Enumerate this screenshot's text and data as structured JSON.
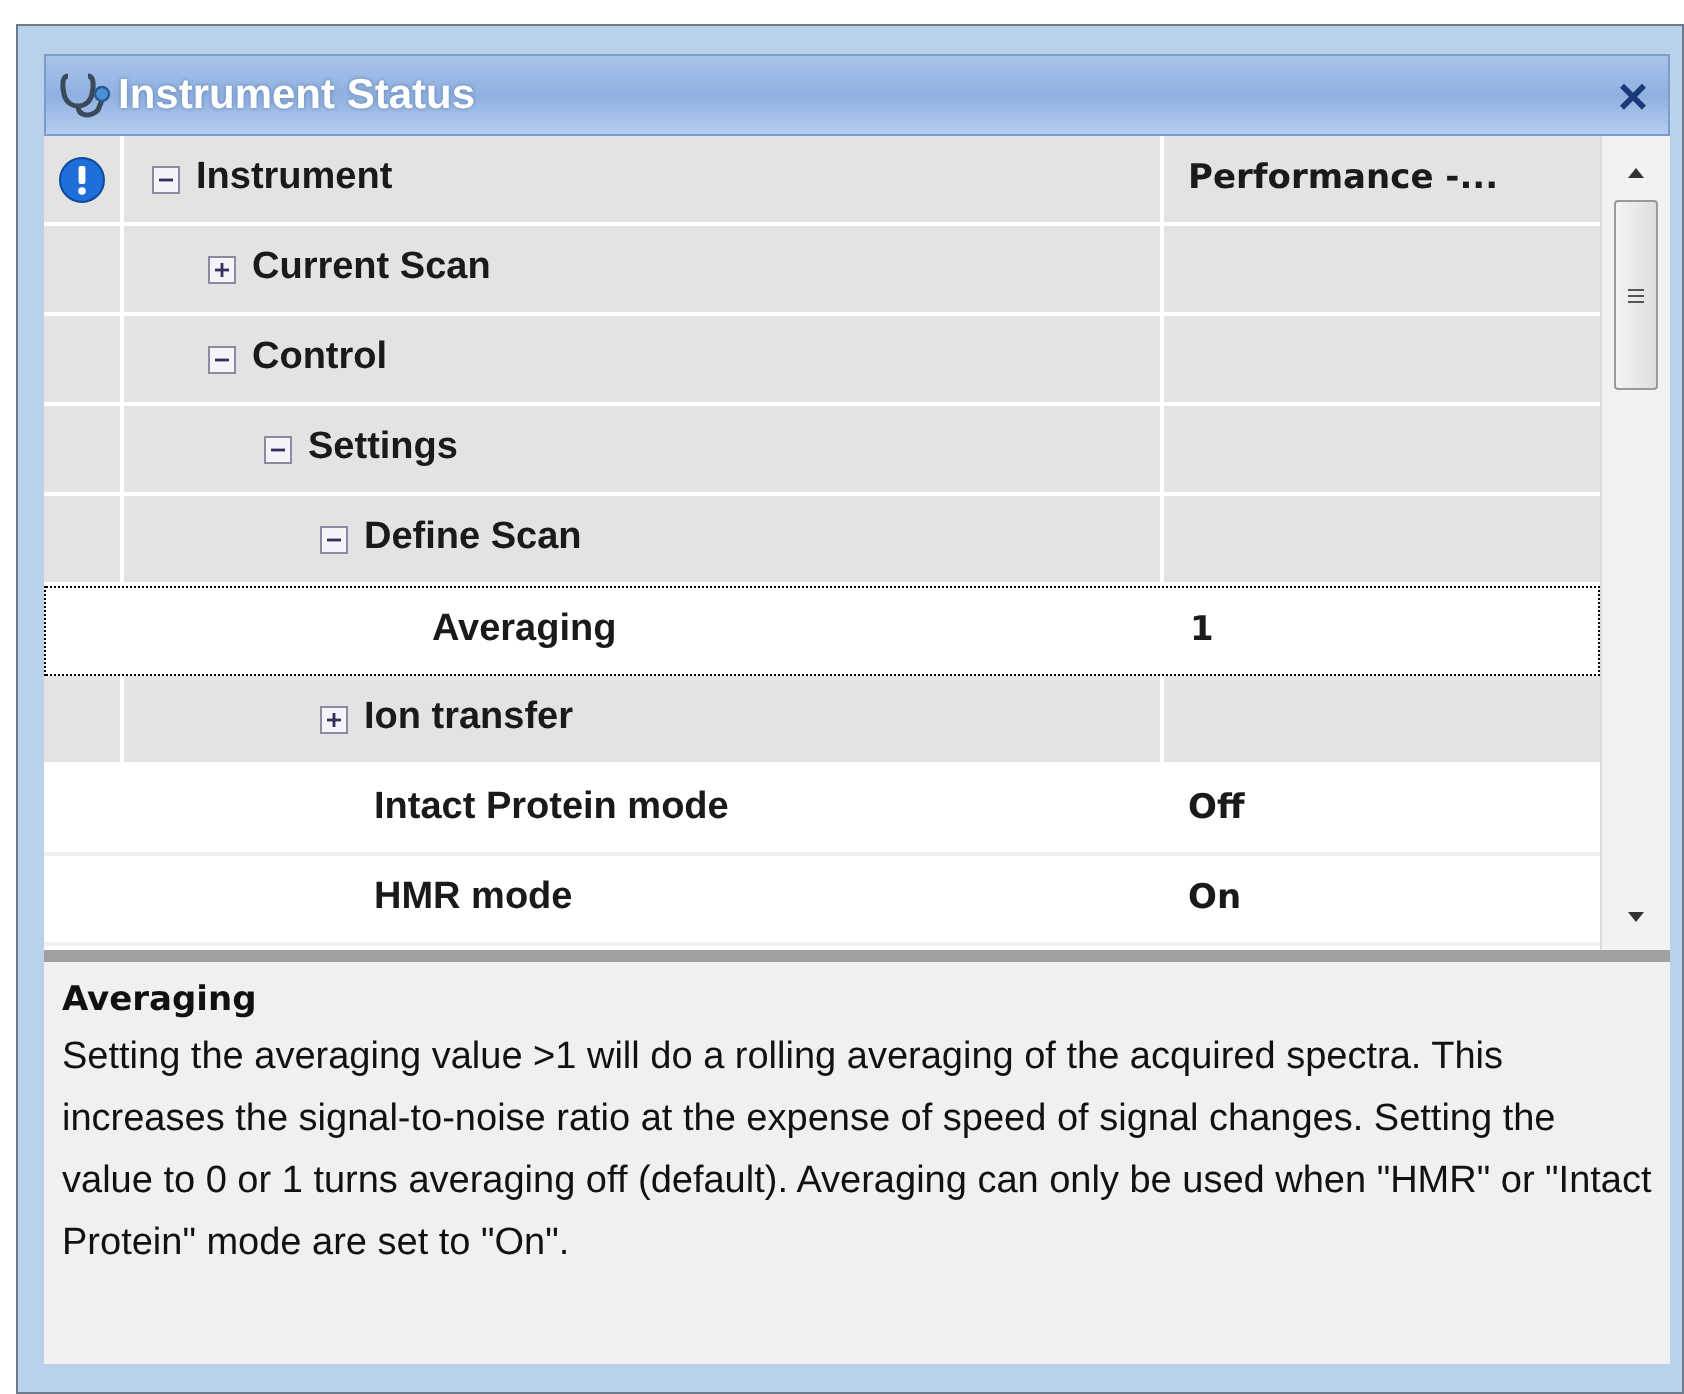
{
  "window": {
    "title": "Instrument Status",
    "close": "×"
  },
  "tree": [
    {
      "name": "Instrument",
      "value": "Performance -...",
      "expanded": true,
      "selected": false,
      "children": [
        {
          "name": "Current Scan",
          "expanded": false,
          "selected": false
        },
        {
          "name": "Control",
          "expanded": true,
          "selected": false,
          "children": [
            {
              "name": "Settings",
              "expanded": true,
              "selected": false,
              "children": [
                {
                  "name": "Define Scan",
                  "expanded": true,
                  "selected": false,
                  "children": [
                    {
                      "name": "Averaging",
                      "value": "1",
                      "selected": true
                    }
                  ]
                },
                {
                  "name": "Ion transfer",
                  "expanded": false,
                  "selected": false
                },
                {
                  "name": "Intact Protein mode",
                  "value": "Off",
                  "selected": false
                },
                {
                  "name": "HMR mode",
                  "value": "On",
                  "selected": false
                }
              ]
            }
          ]
        }
      ]
    }
  ],
  "description": {
    "title": "Averaging",
    "text": "Setting the averaging value >1 will do a rolling averaging of the acquired spectra. This increases the signal-to-noise ratio at the expense of speed of signal changes. Setting the value to 0 or 1 turns averaging off (default). Averaging can only be used when \"HMR\" or \"Intact Protein\" mode are set to \"On\"."
  }
}
